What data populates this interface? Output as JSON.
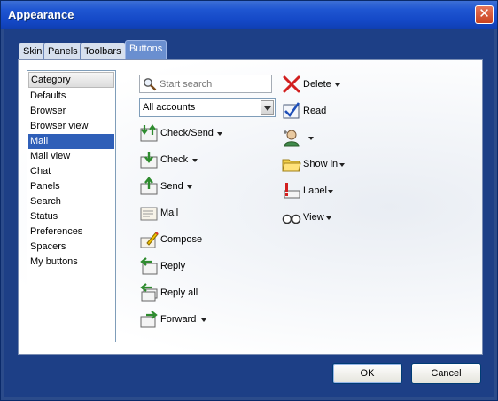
{
  "window": {
    "title": "Appearance"
  },
  "tabs": [
    {
      "label": "Skin"
    },
    {
      "label": "Panels"
    },
    {
      "label": "Toolbars"
    },
    {
      "label": "Buttons",
      "active": true
    }
  ],
  "category": {
    "header": "Category",
    "items": [
      "Defaults",
      "Browser",
      "Browser view",
      "Mail",
      "Mail view",
      "Chat",
      "Panels",
      "Search",
      "Status",
      "Preferences",
      "Spacers",
      "My buttons"
    ],
    "selected": "Mail"
  },
  "search": {
    "placeholder": "Start search"
  },
  "accounts": {
    "value": "All accounts"
  },
  "left_buttons": [
    {
      "label": "Check/Send",
      "icon": "check-send-icon",
      "dropdown": true
    },
    {
      "label": "Check",
      "icon": "check-icon",
      "dropdown": true
    },
    {
      "label": "Send",
      "icon": "send-icon",
      "dropdown": true
    },
    {
      "label": "Mail",
      "icon": "mail-icon",
      "dropdown": false
    },
    {
      "label": "Compose",
      "icon": "compose-icon",
      "dropdown": false
    },
    {
      "label": "Reply",
      "icon": "reply-icon",
      "dropdown": false
    },
    {
      "label": "Reply all",
      "icon": "reply-all-icon",
      "dropdown": false
    },
    {
      "label": "Forward",
      "icon": "forward-icon",
      "dropdown": true
    }
  ],
  "right_buttons": [
    {
      "label": "Delete",
      "icon": "delete-icon",
      "dropdown": true
    },
    {
      "label": "Read",
      "icon": "read-icon",
      "dropdown": false
    },
    {
      "label": "",
      "icon": "contact-icon",
      "dropdown": true
    },
    {
      "label": "Show in",
      "icon": "folder-icon",
      "dropdown": true
    },
    {
      "label": "Label",
      "icon": "label-icon",
      "dropdown": true
    },
    {
      "label": "View",
      "icon": "view-glasses-icon",
      "dropdown": true
    }
  ],
  "footer": {
    "ok_label": "OK",
    "cancel_label": "Cancel"
  },
  "colors": {
    "title_bar": "#1448c6",
    "selection": "#2f5fb8",
    "close": "#c8411f"
  }
}
